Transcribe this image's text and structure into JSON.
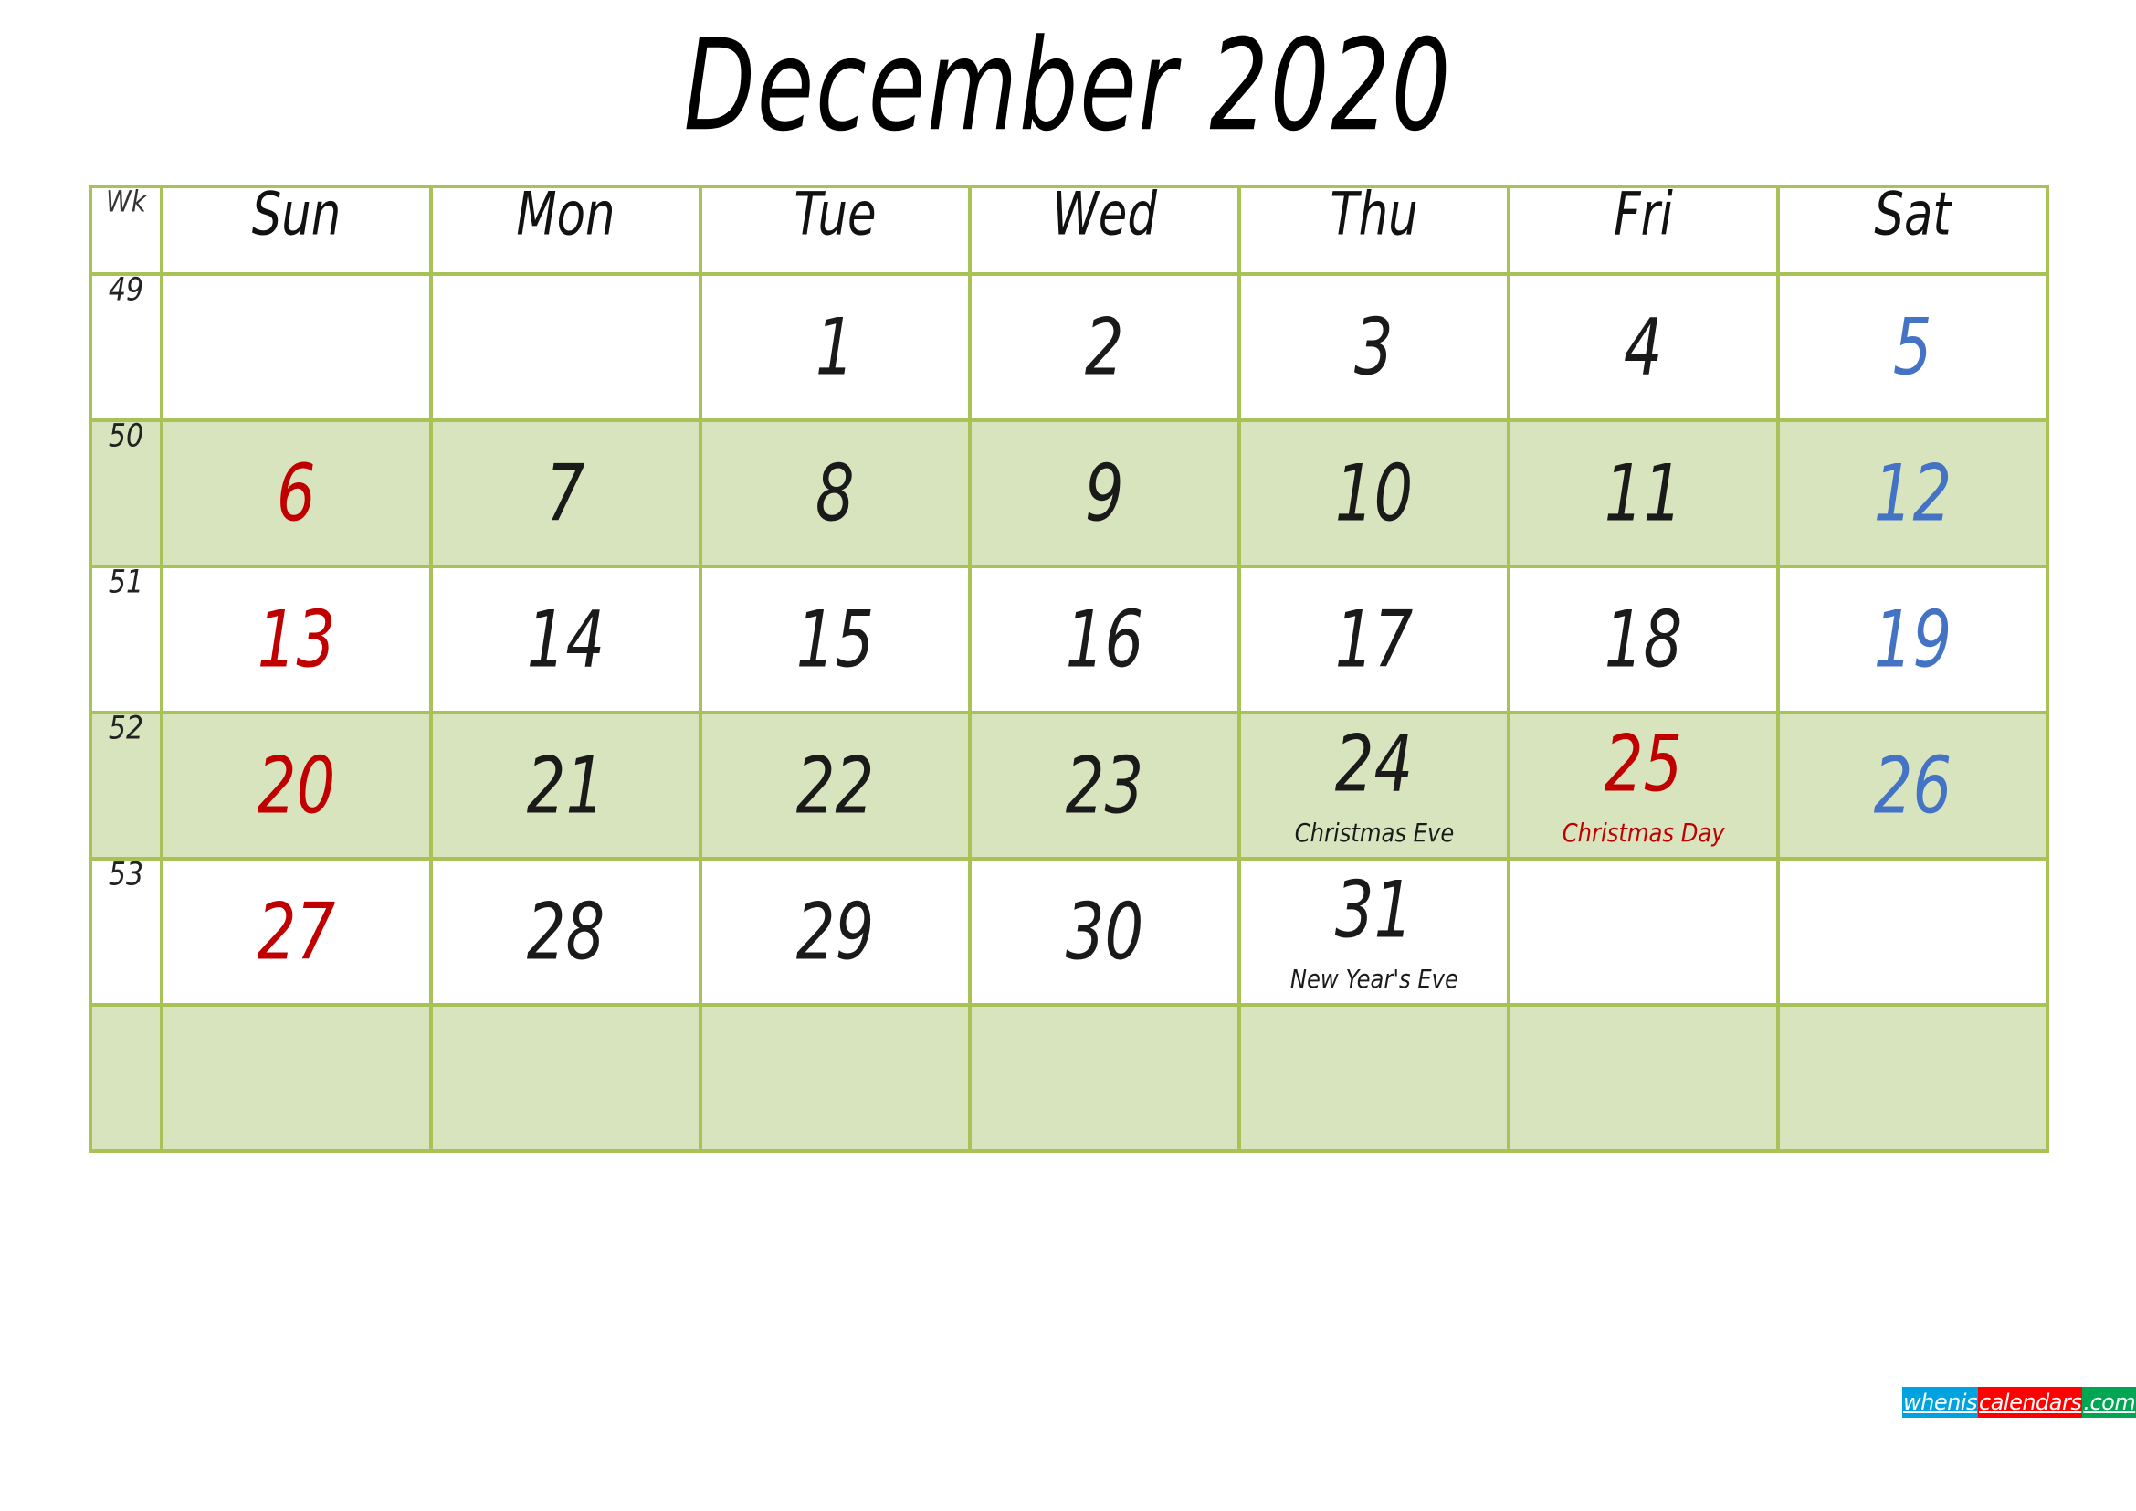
{
  "title": "December 2020",
  "colors": {
    "grid_border": "#A9C257",
    "shade_fill": "#D8E4BE",
    "sunday": "#C00000",
    "saturday": "#4472C4",
    "weekday": "#1a1a1a",
    "logo_blue": "#00A3E0",
    "logo_red": "#FF0000",
    "logo_green": "#00A651"
  },
  "header": {
    "week_label": "Wk",
    "days": [
      "Sun",
      "Mon",
      "Tue",
      "Wed",
      "Thu",
      "Fri",
      "Sat"
    ]
  },
  "weeks": [
    {
      "wk": "49",
      "shaded": false,
      "days": [
        {
          "num": "",
          "note": "",
          "kind": "empty"
        },
        {
          "num": "",
          "note": "",
          "kind": "empty"
        },
        {
          "num": "1",
          "note": "",
          "kind": "weekday"
        },
        {
          "num": "2",
          "note": "",
          "kind": "weekday"
        },
        {
          "num": "3",
          "note": "",
          "kind": "weekday"
        },
        {
          "num": "4",
          "note": "",
          "kind": "weekday"
        },
        {
          "num": "5",
          "note": "",
          "kind": "sat"
        }
      ]
    },
    {
      "wk": "50",
      "shaded": true,
      "days": [
        {
          "num": "6",
          "note": "",
          "kind": "sun"
        },
        {
          "num": "7",
          "note": "",
          "kind": "weekday"
        },
        {
          "num": "8",
          "note": "",
          "kind": "weekday"
        },
        {
          "num": "9",
          "note": "",
          "kind": "weekday"
        },
        {
          "num": "10",
          "note": "",
          "kind": "weekday"
        },
        {
          "num": "11",
          "note": "",
          "kind": "weekday"
        },
        {
          "num": "12",
          "note": "",
          "kind": "sat"
        }
      ]
    },
    {
      "wk": "51",
      "shaded": false,
      "days": [
        {
          "num": "13",
          "note": "",
          "kind": "sun"
        },
        {
          "num": "14",
          "note": "",
          "kind": "weekday"
        },
        {
          "num": "15",
          "note": "",
          "kind": "weekday"
        },
        {
          "num": "16",
          "note": "",
          "kind": "weekday"
        },
        {
          "num": "17",
          "note": "",
          "kind": "weekday"
        },
        {
          "num": "18",
          "note": "",
          "kind": "weekday"
        },
        {
          "num": "19",
          "note": "",
          "kind": "sat"
        }
      ]
    },
    {
      "wk": "52",
      "shaded": true,
      "days": [
        {
          "num": "20",
          "note": "",
          "kind": "sun"
        },
        {
          "num": "21",
          "note": "",
          "kind": "weekday"
        },
        {
          "num": "22",
          "note": "",
          "kind": "weekday"
        },
        {
          "num": "23",
          "note": "",
          "kind": "weekday"
        },
        {
          "num": "24",
          "note": "Christmas Eve",
          "kind": "weekday",
          "note_kind": "weekday"
        },
        {
          "num": "25",
          "note": "Christmas Day",
          "kind": "holiday",
          "note_kind": "holiday"
        },
        {
          "num": "26",
          "note": "",
          "kind": "sat"
        }
      ]
    },
    {
      "wk": "53",
      "shaded": false,
      "days": [
        {
          "num": "27",
          "note": "",
          "kind": "sun"
        },
        {
          "num": "28",
          "note": "",
          "kind": "weekday"
        },
        {
          "num": "29",
          "note": "",
          "kind": "weekday"
        },
        {
          "num": "30",
          "note": "",
          "kind": "weekday"
        },
        {
          "num": "31",
          "note": "New Year's Eve",
          "kind": "weekday",
          "note_kind": "weekday"
        },
        {
          "num": "",
          "note": "",
          "kind": "empty"
        },
        {
          "num": "",
          "note": "",
          "kind": "empty"
        }
      ]
    },
    {
      "wk": "",
      "shaded": true,
      "days": [
        {
          "num": "",
          "note": "",
          "kind": "empty"
        },
        {
          "num": "",
          "note": "",
          "kind": "empty"
        },
        {
          "num": "",
          "note": "",
          "kind": "empty"
        },
        {
          "num": "",
          "note": "",
          "kind": "empty"
        },
        {
          "num": "",
          "note": "",
          "kind": "empty"
        },
        {
          "num": "",
          "note": "",
          "kind": "empty"
        },
        {
          "num": "",
          "note": "",
          "kind": "empty"
        }
      ]
    }
  ],
  "logo": {
    "part1": "whenis",
    "part2": "calendars",
    "part3": ".com"
  }
}
